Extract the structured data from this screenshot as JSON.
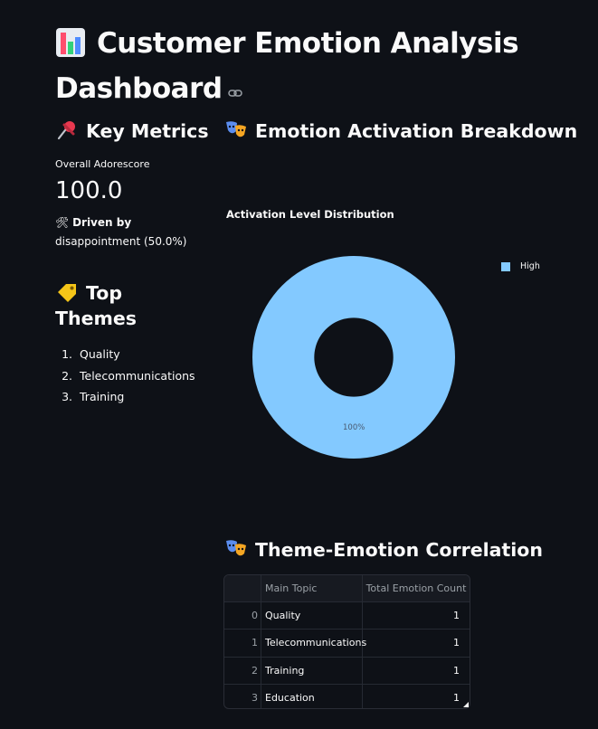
{
  "page": {
    "title": "Customer Emotion Analysis Dashboard",
    "title_icon": "bar-chart-icon",
    "anchor_icon": "link-icon"
  },
  "key_metrics": {
    "heading": "Key Metrics",
    "heading_icon": "pushpin-icon",
    "metric_label": "Overall Adorescore",
    "metric_value": "100.0",
    "driven_icon": "hammer-wrench-icon",
    "driven_prefix": "Driven by",
    "driven_emotion": "disappointment",
    "driven_pct": "(50.0%)"
  },
  "top_themes": {
    "heading": "Top Themes",
    "heading_icon": "label-tag-icon",
    "items": [
      "Quality",
      "Telecommunications",
      "Training"
    ]
  },
  "activation": {
    "heading": "Emotion Activation Breakdown",
    "heading_icon": "performing-arts-icon"
  },
  "chart_data": {
    "type": "pie",
    "title": "Activation Level Distribution",
    "categories": [
      "High"
    ],
    "values": [
      100
    ],
    "labels": [
      "100%"
    ],
    "colors": [
      "#83c9ff"
    ],
    "hole": 0.39,
    "legend": "top-right"
  },
  "correlation": {
    "heading": "Theme-Emotion Correlation",
    "heading_icon": "performing-arts-icon",
    "columns": [
      "Main Topic",
      "Total Emotion Count"
    ],
    "rows": [
      {
        "index": "0",
        "topic": "Quality",
        "count": "1"
      },
      {
        "index": "1",
        "topic": "Telecommunications",
        "count": "1"
      },
      {
        "index": "2",
        "topic": "Training",
        "count": "1"
      },
      {
        "index": "3",
        "topic": "Education",
        "count": "1"
      }
    ]
  },
  "colors": {
    "background": "#0e1117",
    "accent_blue": "#83c9ff",
    "text": "#fafafa"
  }
}
